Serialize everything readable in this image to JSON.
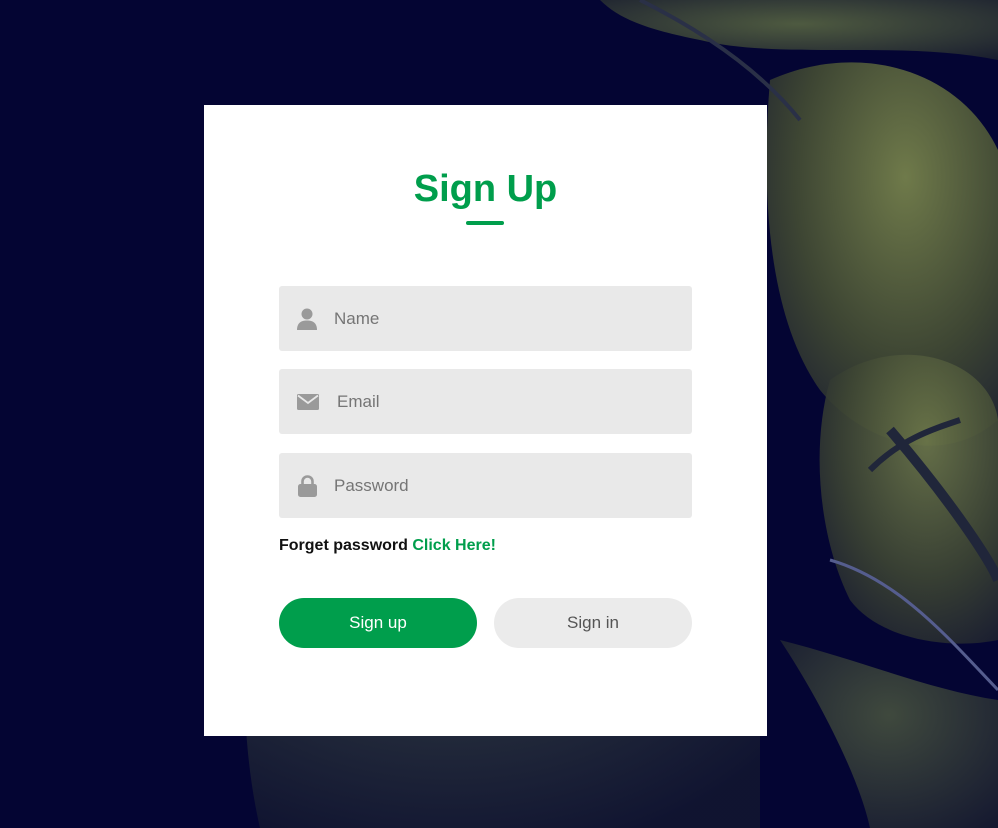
{
  "form": {
    "title": "Sign Up",
    "fields": [
      {
        "icon": "user-icon",
        "placeholder": "Name",
        "value": ""
      },
      {
        "icon": "envelope-icon",
        "placeholder": "Email",
        "value": ""
      },
      {
        "icon": "lock-icon",
        "placeholder": "Password",
        "value": ""
      }
    ],
    "forget_text": "Forget password",
    "forget_link": "Click Here!",
    "signup_label": "Sign up",
    "signin_label": "Sign in"
  },
  "colors": {
    "accent": "#009e4c",
    "background": "#040533",
    "field_bg": "#e9e9e9",
    "icon": "#9a9a9a"
  }
}
